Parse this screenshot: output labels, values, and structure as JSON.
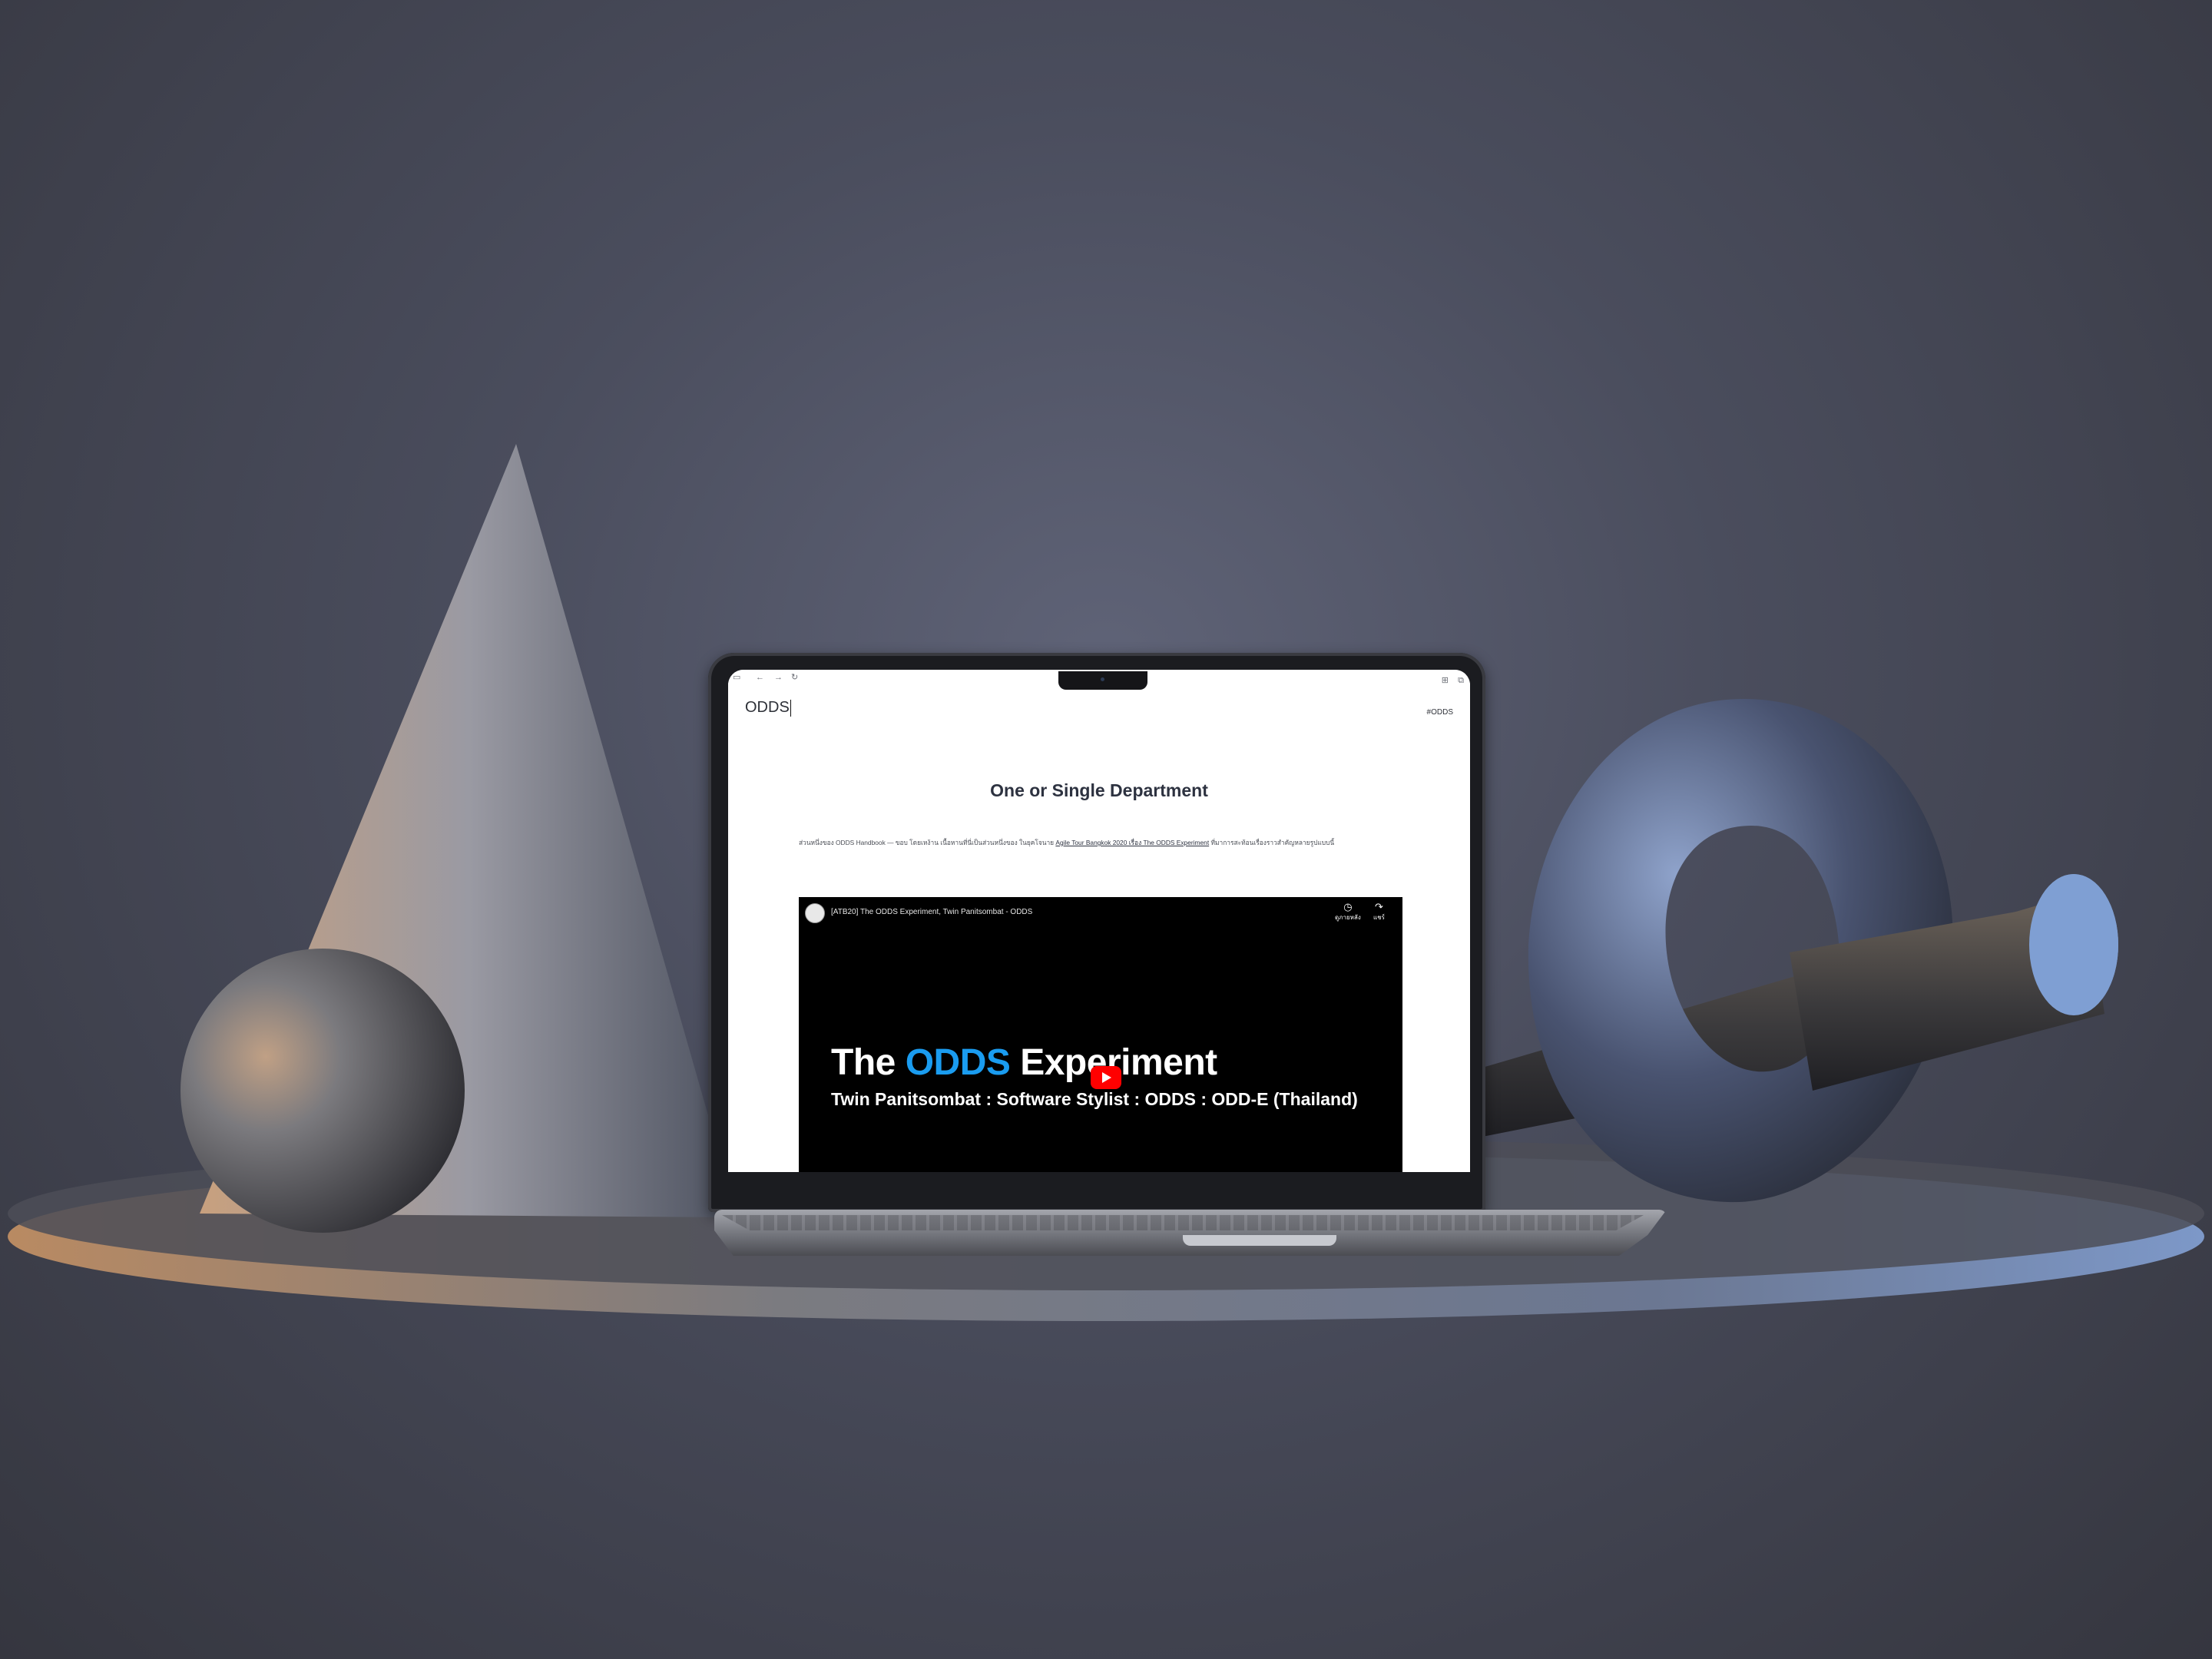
{
  "browser": {
    "sidebar_icon": "sidebar-icon",
    "back_icon": "back-arrow-icon",
    "forward_icon": "forward-arrow-icon",
    "reload_icon": "reload-icon"
  },
  "site": {
    "logo": "ODDS",
    "nav_link": "#ODDS"
  },
  "page": {
    "title": "One or Single Department",
    "intro_text": "ส่วนหนึ่งของ ODDS Handbook — ขอบ โดยเหง้าน เนื้อหานที่นี่เป็นส่วนหนึ่งของ ในยุคโจนาย",
    "intro_link": "Agile Tour Bangkok 2020 เรื่อง The ODDS Experiment",
    "intro_tail": "ที่มาการสะท้อนเรื่องราวสำคัญหลายรูปแบบนี้"
  },
  "video": {
    "channel_title": "[ATB20] The ODDS Experiment, Twin Panitsombat - ODDS",
    "watch_later_label": "ดูภายหลัง",
    "share_label": "แชร์",
    "headline_prefix": "The",
    "headline_accent": "ODDS",
    "headline_suffix": "Experiment",
    "subtitle": "Twin Panitsombat : Software Stylist : ODDS : ODD-E (Thailand)"
  },
  "colors": {
    "accent_blue": "#1a9cf0",
    "youtube_red": "#ff0000"
  }
}
